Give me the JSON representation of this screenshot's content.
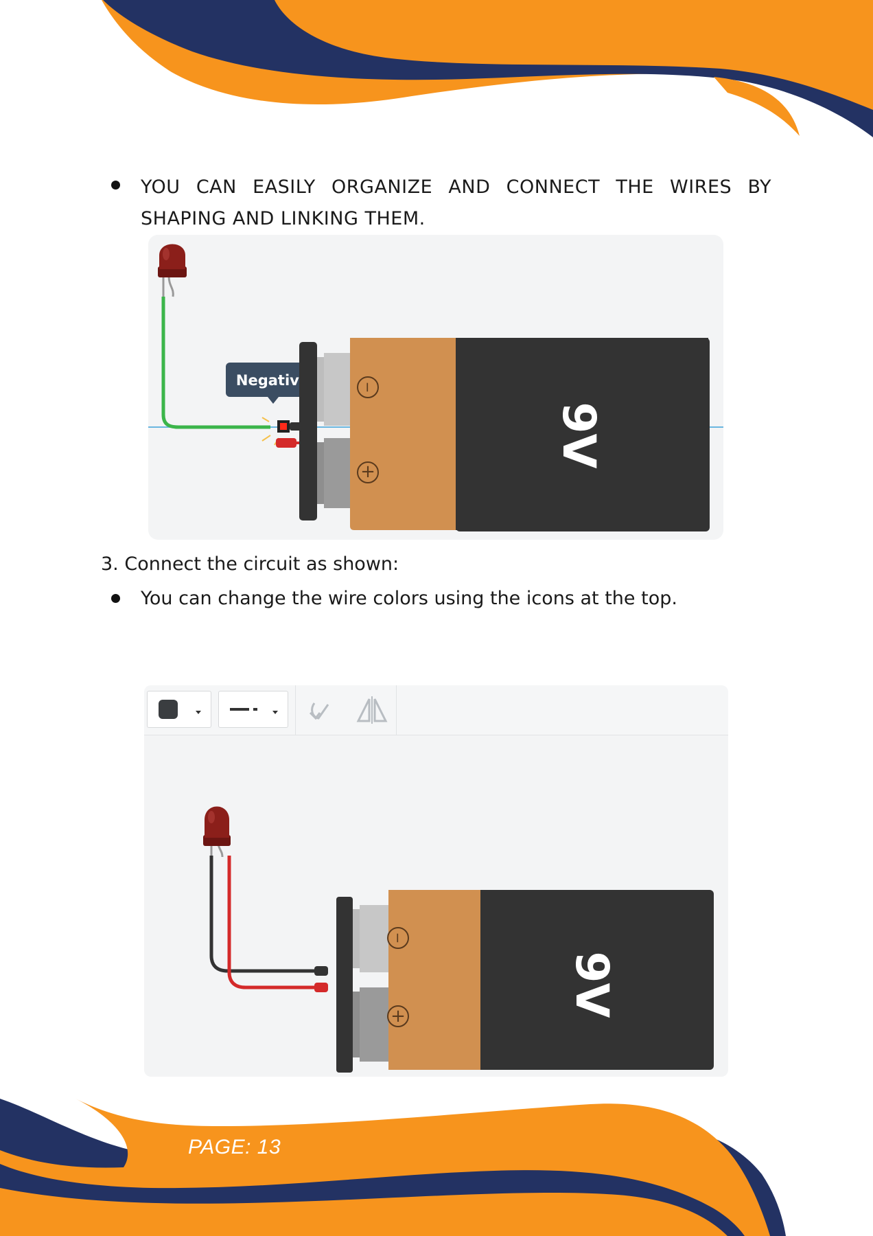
{
  "bullets": {
    "organize_wires": "YOU CAN EASILY ORGANIZE AND CONNECT THE WIRES BY SHAPING AND LINKING THEM.",
    "wire_colors": "You can change the wire colors using the icons at the top."
  },
  "step": {
    "text": "3. Connect the circuit as shown:"
  },
  "figure1": {
    "tooltip": "Negative",
    "battery_label": "9V",
    "minus_symbol": "−",
    "plus_symbol": "+"
  },
  "figure2": {
    "battery_label": "9V",
    "minus_symbol": "−",
    "plus_symbol": "+",
    "toolbar": {
      "color_picker_icon": "square-color-icon",
      "line_style_icon": "dashed-line-icon",
      "rotate_icon": "rotate-icon",
      "flip_icon": "flip-icon"
    }
  },
  "footer": {
    "page_label": "PAGE: 13"
  },
  "colors": {
    "orange": "#F7941D",
    "navy": "#233263",
    "battery_tan": "#D19050",
    "battery_black": "#333333",
    "wire_green": "#3BB54A",
    "wire_red": "#D42A2A",
    "wire_black": "#333333"
  }
}
